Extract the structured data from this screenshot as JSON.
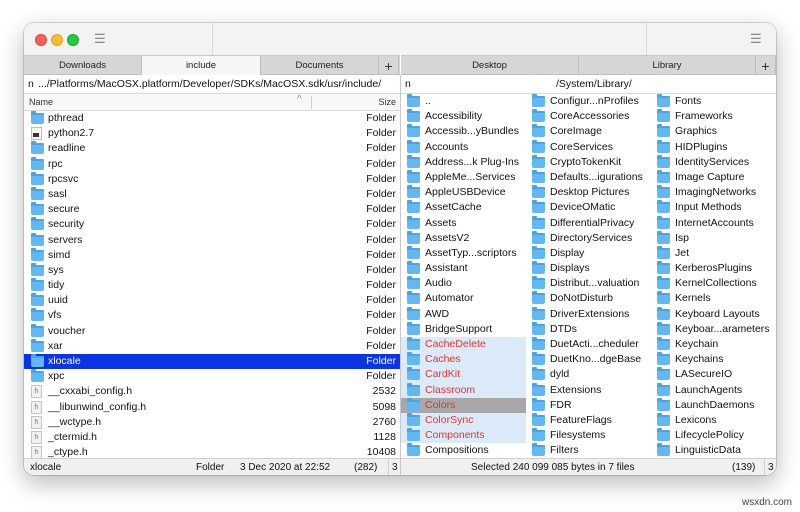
{
  "left_pane": {
    "tabs": [
      {
        "label": "Downloads"
      },
      {
        "label": "include"
      },
      {
        "label": "Documents"
      }
    ],
    "add_tab": "+",
    "path_prefix": "n",
    "path": ".../Platforms/MacOSX.platform/Developer/SDKs/MacOSX.sdk/usr/include/",
    "columns": {
      "name": "Name",
      "sort": "^",
      "size": "Size"
    },
    "rows": [
      {
        "name": "pthread",
        "size": "Folder",
        "icon": "folder-icon"
      },
      {
        "name": "python2.7",
        "size": "Folder",
        "icon": "executable-icon"
      },
      {
        "name": "readline",
        "size": "Folder",
        "icon": "folder-icon"
      },
      {
        "name": "rpc",
        "size": "Folder",
        "icon": "folder-icon"
      },
      {
        "name": "rpcsvc",
        "size": "Folder",
        "icon": "folder-icon"
      },
      {
        "name": "sasl",
        "size": "Folder",
        "icon": "folder-icon"
      },
      {
        "name": "secure",
        "size": "Folder",
        "icon": "folder-icon"
      },
      {
        "name": "security",
        "size": "Folder",
        "icon": "folder-icon"
      },
      {
        "name": "servers",
        "size": "Folder",
        "icon": "folder-icon"
      },
      {
        "name": "simd",
        "size": "Folder",
        "icon": "folder-icon"
      },
      {
        "name": "sys",
        "size": "Folder",
        "icon": "folder-icon"
      },
      {
        "name": "tidy",
        "size": "Folder",
        "icon": "folder-icon"
      },
      {
        "name": "uuid",
        "size": "Folder",
        "icon": "folder-icon"
      },
      {
        "name": "vfs",
        "size": "Folder",
        "icon": "folder-icon"
      },
      {
        "name": "voucher",
        "size": "Folder",
        "icon": "folder-icon"
      },
      {
        "name": "xar",
        "size": "Folder",
        "icon": "folder-icon"
      },
      {
        "name": "xlocale",
        "size": "Folder",
        "icon": "folder-icon",
        "selected": true
      },
      {
        "name": "xpc",
        "size": "Folder",
        "icon": "folder-icon"
      },
      {
        "name": "__cxxabi_config.h",
        "size": "2532",
        "icon": "header-file-icon"
      },
      {
        "name": "__libunwind_config.h",
        "size": "5098",
        "icon": "header-file-icon"
      },
      {
        "name": "__wctype.h",
        "size": "2760",
        "icon": "header-file-icon"
      },
      {
        "name": "_ctermid.h",
        "size": "1128",
        "icon": "header-file-icon"
      },
      {
        "name": "_ctype.h",
        "size": "10408",
        "icon": "header-file-icon"
      }
    ],
    "status": {
      "name": "xlocale",
      "kind": "Folder",
      "date": "3 Dec 2020 at 22:52",
      "count": "(282)",
      "extra": "3"
    }
  },
  "right_pane": {
    "tabs": [
      {
        "label": "Desktop"
      },
      {
        "label": "Library"
      }
    ],
    "add_tab": "+",
    "path_prefix": "n",
    "path": "/System/Library/",
    "columns": [
      [
        {
          "name": ".."
        },
        {
          "name": "Accessibility"
        },
        {
          "name": "Accessib...yBundles"
        },
        {
          "name": "Accounts"
        },
        {
          "name": "Address...k Plug-Ins"
        },
        {
          "name": "AppleMe...Services"
        },
        {
          "name": "AppleUSBDevice"
        },
        {
          "name": "AssetCache"
        },
        {
          "name": "Assets"
        },
        {
          "name": "AssetsV2"
        },
        {
          "name": "AssetTyp...scriptors"
        },
        {
          "name": "Assistant"
        },
        {
          "name": "Audio"
        },
        {
          "name": "Automator"
        },
        {
          "name": "AWD"
        },
        {
          "name": "BridgeSupport"
        },
        {
          "name": "CacheDelete",
          "marked": true
        },
        {
          "name": "Caches",
          "marked": true
        },
        {
          "name": "CardKit",
          "marked": true
        },
        {
          "name": "Classroom",
          "marked": true
        },
        {
          "name": "Colors",
          "marked": true,
          "current": true
        },
        {
          "name": "ColorSync",
          "marked": true
        },
        {
          "name": "Components",
          "marked": true
        },
        {
          "name": "Compositions"
        }
      ],
      [
        {
          "name": "Configur...nProfiles"
        },
        {
          "name": "CoreAccessories"
        },
        {
          "name": "CoreImage"
        },
        {
          "name": "CoreServices"
        },
        {
          "name": "CryptoTokenKit"
        },
        {
          "name": "Defaults...igurations"
        },
        {
          "name": "Desktop Pictures"
        },
        {
          "name": "DeviceOMatic"
        },
        {
          "name": "DifferentialPrivacy"
        },
        {
          "name": "DirectoryServices"
        },
        {
          "name": "Display"
        },
        {
          "name": "Displays"
        },
        {
          "name": "Distribut...valuation"
        },
        {
          "name": "DoNotDisturb"
        },
        {
          "name": "DriverExtensions"
        },
        {
          "name": "DTDs"
        },
        {
          "name": "DuetActi...cheduler"
        },
        {
          "name": "DuetKno...dgeBase"
        },
        {
          "name": "dyld"
        },
        {
          "name": "Extensions"
        },
        {
          "name": "FDR"
        },
        {
          "name": "FeatureFlags"
        },
        {
          "name": "Filesystems"
        },
        {
          "name": "Filters"
        }
      ],
      [
        {
          "name": "Fonts"
        },
        {
          "name": "Frameworks"
        },
        {
          "name": "Graphics"
        },
        {
          "name": "HIDPlugins"
        },
        {
          "name": "IdentityServices"
        },
        {
          "name": "Image Capture"
        },
        {
          "name": "ImagingNetworks"
        },
        {
          "name": "Input Methods"
        },
        {
          "name": "InternetAccounts"
        },
        {
          "name": "Isp"
        },
        {
          "name": "Jet"
        },
        {
          "name": "KerberosPlugins"
        },
        {
          "name": "KernelCollections"
        },
        {
          "name": "Kernels"
        },
        {
          "name": "Keyboard Layouts"
        },
        {
          "name": "Keyboar...arameters"
        },
        {
          "name": "Keychain"
        },
        {
          "name": "Keychains"
        },
        {
          "name": "LASecureIO"
        },
        {
          "name": "LaunchAgents"
        },
        {
          "name": "LaunchDaemons"
        },
        {
          "name": "Lexicons"
        },
        {
          "name": "LifecyclePolicy"
        },
        {
          "name": "LinguisticData"
        }
      ]
    ],
    "status": {
      "text": "Selected 240 099 085 bytes in 7 files",
      "count": "(139)",
      "extra": "3"
    }
  },
  "watermark": "wsxdn.com",
  "colors": {
    "selection": "#0a34e5",
    "marked_text": "#e8322a",
    "folder": "#62b8f2"
  }
}
